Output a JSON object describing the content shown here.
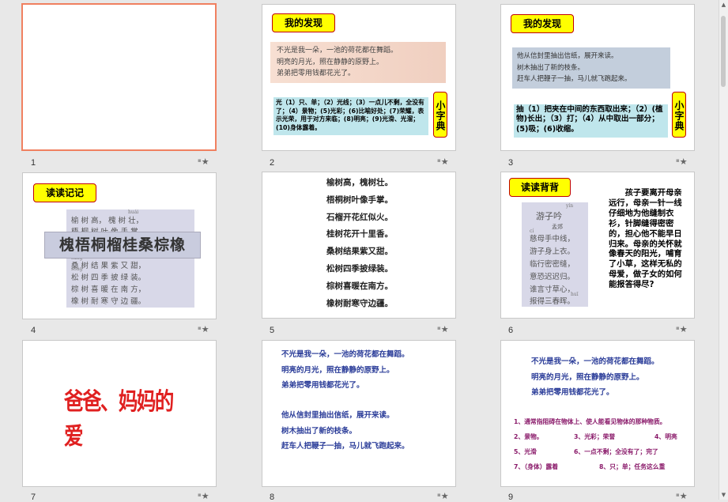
{
  "slides": [
    {
      "number": "1"
    },
    {
      "number": "2",
      "title": "我的发现",
      "picture_lines": [
        "不光是我一朵，一池的荷花都在舞蹈。",
        "明亮的月光，照在静静的原野上。",
        "弟弟把零用钱都花光了。"
      ],
      "definition": "光（1）只、单；（2）光线；（3）一点儿不剩，全没有了；（4）景物；(5)光彩；(6)比喻好处；(7)荣耀，表示光荣，用于对方来临；(8)明亮；(9)光滑、光溜；(10)身体露着。",
      "dict_label": "小字典"
    },
    {
      "number": "3",
      "title": "我的发现",
      "picture_lines": [
        "他从信封里抽出信纸，展开来读。",
        "树木抽出了新的枝条。",
        "赶车人把鞭子一抽，马儿就飞跑起来。"
      ],
      "definition": "抽（1）把夹在中间的东西取出来；（2）(植物)长出；（3）打；（4）从中取出一部分；(5)吸；(6)收缩。",
      "dict_label": "小字典"
    },
    {
      "number": "4",
      "title": "读读记记",
      "pinyin_top": "huái",
      "picture_lines": [
        "榆 树 高， 槐 树 壮，",
        "梧 桐 树 叶 像 手 掌。"
      ],
      "pinyin_lines": [
        "sāng",
        "sōng"
      ],
      "band_text": "槐梧桐榴桂桑棕橡",
      "picture_lines_after": [
        "桑 树 结 果 紫 又 甜，",
        "松 树 四 季 披 绿 装。",
        "棕 树 喜 暖 在 南 方，",
        "橡 树 耐 寒 守 边 疆。"
      ]
    },
    {
      "number": "5",
      "poem_lines": [
        "榆树高，槐树壮。",
        "梧桐树叶像手掌。",
        "石榴开花红似火。",
        "桂树花开十里香。",
        "桑树结果紫又甜。",
        "松树四季披绿装。",
        "棕树喜暖在南方。",
        "橡树耐寒守边疆。"
      ]
    },
    {
      "number": "6",
      "title": "读读背背",
      "poem_title": "游子吟",
      "poem_pinyin": "yín",
      "poem_author": "孟郊",
      "poem_lines": [
        "慈母手中线，",
        "游子身上衣。",
        "临行密密缝，",
        "意恐迟迟归。",
        "谁言寸草心，",
        "报得三春晖。"
      ],
      "poem_pinyin_lines": [
        "cí",
        "",
        "",
        "",
        "",
        "huī"
      ],
      "commentary": "孩子要离开母亲远行，母亲一针一线仔细地为他缝制衣衫，针脚缝得密密的，担心他不能早日归来。母亲的关怀就像春天的阳光，哺育了小草，这样无私的母爱，做子女的如何能报答得尽?"
    },
    {
      "number": "7",
      "big_title": "爸爸、妈妈的爱"
    },
    {
      "number": "8",
      "lines_a": [
        "不光是我一朵，一池的荷花都在舞蹈。",
        "明亮的月光，照在静静的原野上。",
        "弟弟把零用钱都花光了。"
      ],
      "lines_b": [
        "他从信封里抽出信纸，展开来读。",
        "树木抽出了新的枝条。",
        "赶车人把鞭子一抽，马儿就飞跑起来。"
      ]
    },
    {
      "number": "9",
      "lines_a": [
        "不光是我一朵，一池的荷花都在舞蹈。",
        "明亮的月光，照在静静的原野上。",
        "弟弟把零用钱都花光了。"
      ],
      "meanings": [
        "1、通常指阻碍在物体上、使人能看见物体的那种物质。",
        "2、景物。",
        "3、光彩；荣誉",
        "4、明亮",
        "5、光滑",
        "6、一点不剩；全没有了；完了",
        "7、（身体）露着",
        "8、只；单；任务这么重"
      ]
    }
  ],
  "star_glyph": "★",
  "colors": {
    "accent": "#f08060",
    "title_fill": "#ffff00",
    "title_border": "#c00000",
    "definition_bg": "#bfe6ec",
    "blue_text": "#2b3d99",
    "purple_text": "#8a1a6a",
    "red_title": "#e02020"
  }
}
